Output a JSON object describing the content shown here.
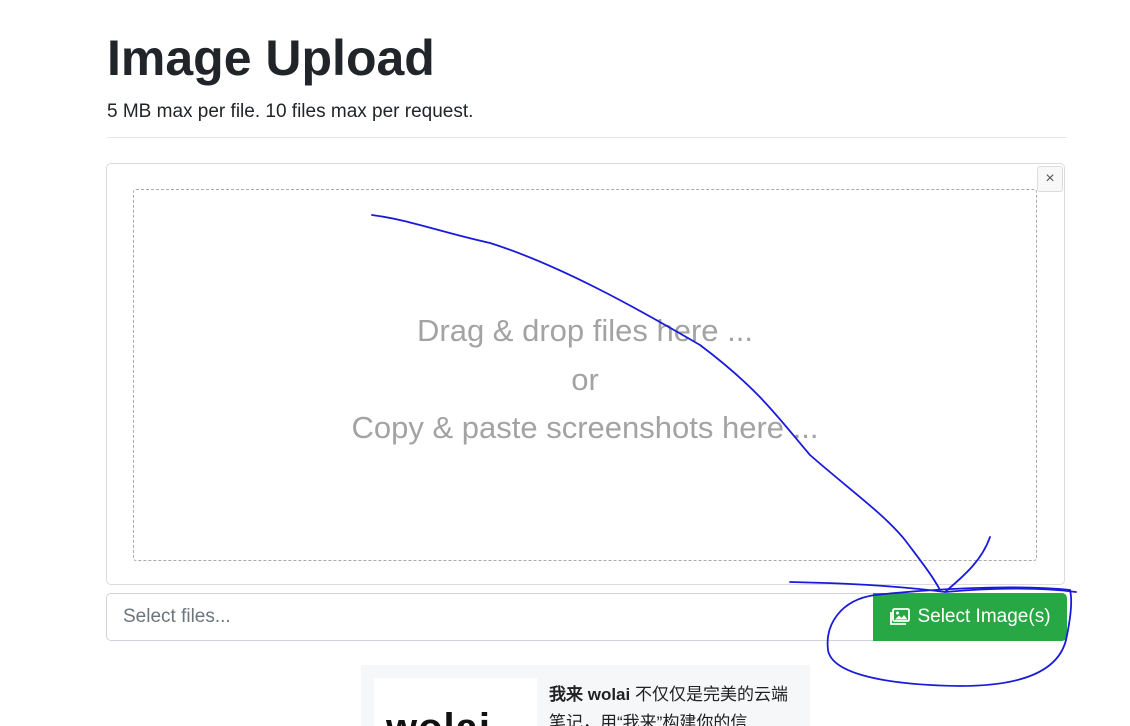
{
  "header": {
    "title": "Image Upload",
    "subtitle": "5 MB max per file. 10 files max per request."
  },
  "dropzone": {
    "line1": "Drag & drop files here ...",
    "line2": "or",
    "line3": "Copy & paste screenshots here ...",
    "close_label": "×"
  },
  "file_input": {
    "placeholder": "Select files...",
    "value": ""
  },
  "select_button": {
    "label": "Select Image(s)",
    "icon": "images-icon",
    "color": "#28a745"
  },
  "ad": {
    "brand": "我来 wolai",
    "text": " 不仅仅是完美的云端笔记，用“我来”构建你的信",
    "logo_text": "wolai"
  },
  "colors": {
    "annotation": "#1a1adb"
  }
}
